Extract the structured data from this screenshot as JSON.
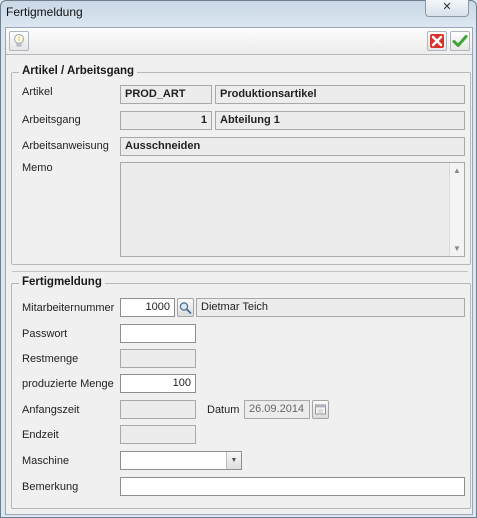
{
  "window": {
    "title": "Fertigmeldung",
    "close_glyph": "✕"
  },
  "toolbar": {
    "hint_icon": "lightbulb-icon",
    "cancel_icon": "red-x-icon",
    "ok_icon": "green-check-icon"
  },
  "artikel_group": {
    "title": "Artikel / Arbeitsgang",
    "artikel_label": "Artikel",
    "artikel_code": "PROD_ART",
    "artikel_name": "Produktionsartikel",
    "arbeitsgang_label": "Arbeitsgang",
    "arbeitsgang_nr": "1",
    "arbeitsgang_name": "Abteilung 1",
    "anweisung_label": "Arbeitsanweisung",
    "anweisung_value": "Ausschneiden",
    "memo_label": "Memo",
    "memo_value": ""
  },
  "fertig_group": {
    "title": "Fertigmeldung",
    "mitarbeiter_label": "Mitarbeiternummer",
    "mitarbeiter_nr": "1000",
    "mitarbeiter_name": "Dietmar Teich",
    "passwort_label": "Passwort",
    "passwort_value": "",
    "restmenge_label": "Restmenge",
    "restmenge_value": "",
    "menge_label": "produzierte Menge",
    "menge_value": "100",
    "anfangszeit_label": "Anfangszeit",
    "anfangszeit_value": "",
    "datum_label": "Datum",
    "datum_value": "26.09.2014",
    "endzeit_label": "Endzeit",
    "endzeit_value": "",
    "maschine_label": "Maschine",
    "maschine_value": "",
    "bemerkung_label": "Bemerkung",
    "bemerkung_value": ""
  },
  "colors": {
    "cancel_red": "#d9342b",
    "ok_green": "#3fa535",
    "field_bg": "#ececec"
  }
}
